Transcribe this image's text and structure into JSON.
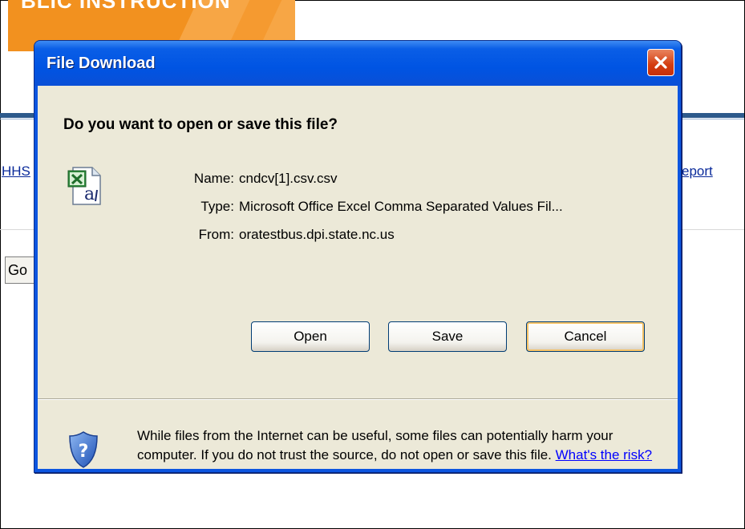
{
  "background_page": {
    "banner_text": "BLIC INSTRUCTION",
    "link_left": "HHS",
    "link_right": "eport",
    "go_button": "Go"
  },
  "dialog": {
    "title": "File Download",
    "question": "Do you want to open or save this file?",
    "file": {
      "name_label": "Name:",
      "name_value": "cndcv[1].csv.csv",
      "type_label": "Type:",
      "type_value": "Microsoft Office Excel Comma Separated Values Fil...",
      "from_label": "From:",
      "from_value": "oratestbus.dpi.state.nc.us"
    },
    "buttons": {
      "open": "Open",
      "save": "Save",
      "cancel": "Cancel"
    },
    "warning_text": "While files from the Internet can be useful, some files can potentially harm your computer. If you do not trust the source, do not open or save this file.",
    "risk_link": "What's the risk?"
  },
  "colors": {
    "title_bar": "#0054e3",
    "dialog_body": "#ece9d8",
    "banner": "#f2911f"
  }
}
